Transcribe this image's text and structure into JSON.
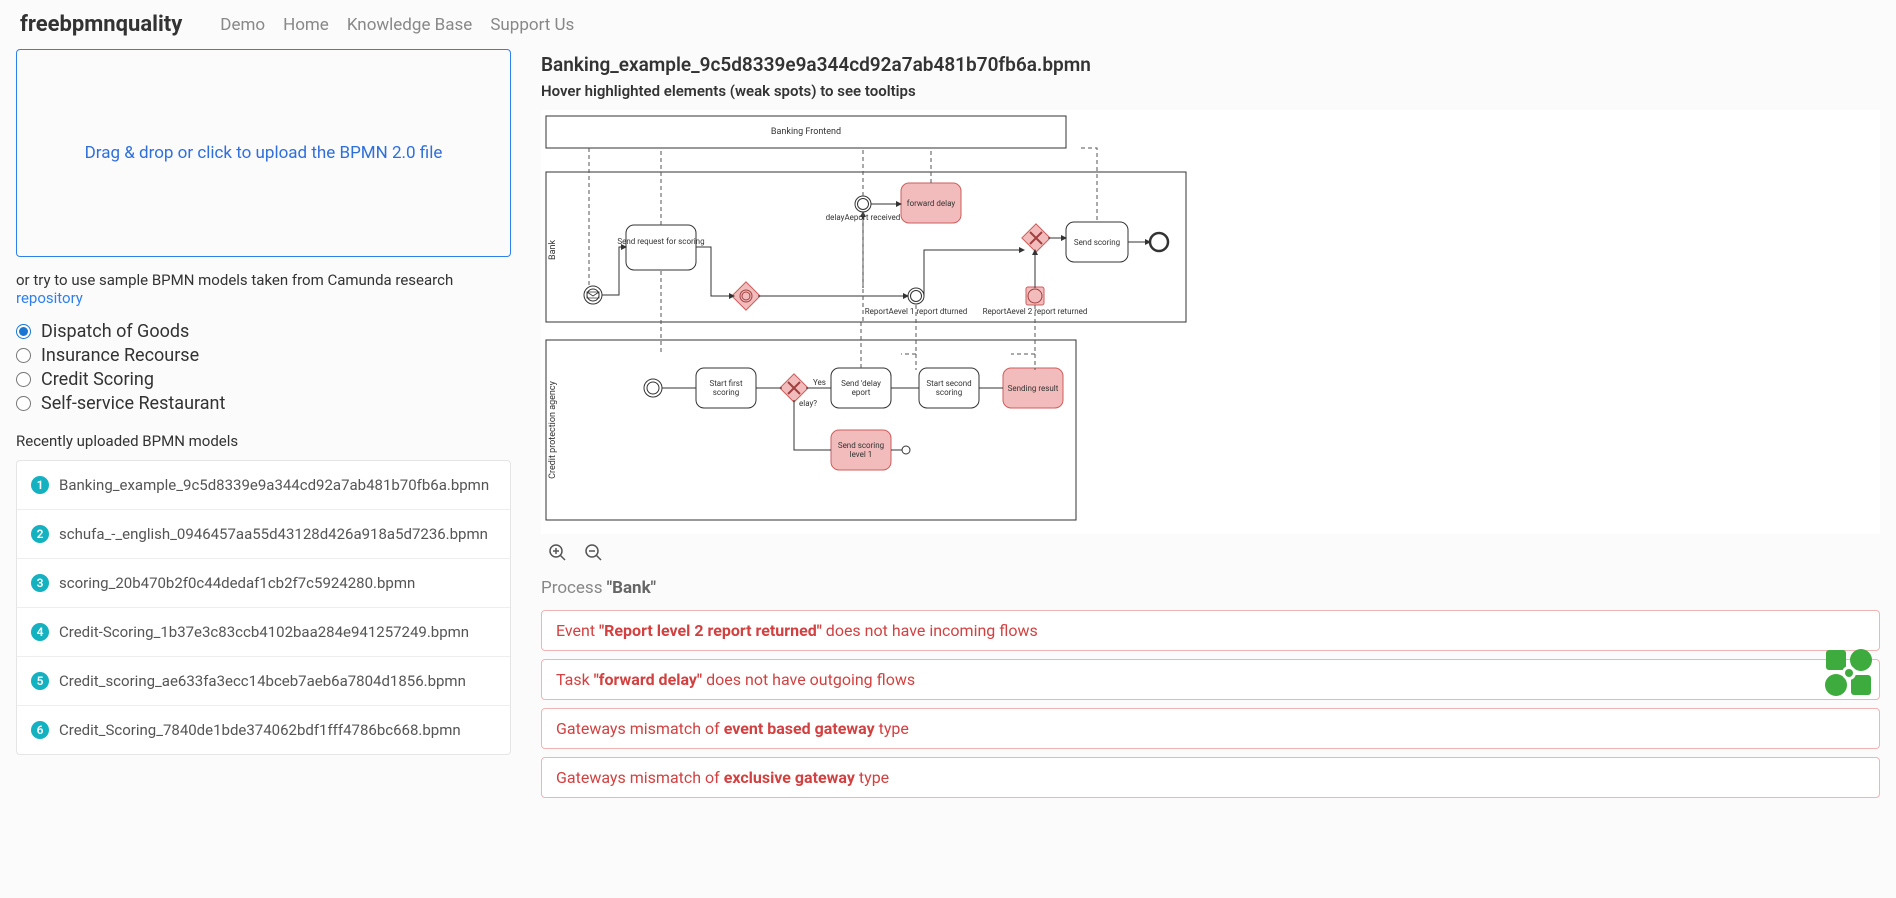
{
  "nav": {
    "brand": "freebpmnquality",
    "links": [
      "Demo",
      "Home",
      "Knowledge Base",
      "Support Us"
    ]
  },
  "upload": {
    "label": "Drag & drop or click to upload the BPMN 2.0 file"
  },
  "hint": {
    "prefix": "or try to use sample BPMN models taken from Camunda research ",
    "link": "repository"
  },
  "samples": [
    "Dispatch of Goods",
    "Insurance Recourse",
    "Credit Scoring",
    "Self-service Restaurant"
  ],
  "recent_label": "Recently uploaded BPMN models",
  "recent": [
    "Banking_example_9c5d8339e9a344cd92a7ab481b70fb6a.bpmn",
    "schufa_-_english_0946457aa55d43128d426a918a5d7236.bpmn",
    "scoring_20b470b2f0c44dedaf1cb2f7c5924280.bpmn",
    "Credit-Scoring_1b37e3c83ccb4102baa284e941257249.bpmn",
    "Credit_scoring_ae633fa3ecc14bceb7aeb6a7804d1856.bpmn",
    "Credit_Scoring_7840de1bde374062bdf1fff4786bc668.bpmn"
  ],
  "file": {
    "title": "Banking_example_9c5d8339e9a344cd92a7ab481b70fb6a.bpmn",
    "subtitle": "Hover highlighted elements (weak spots) to see tooltips"
  },
  "diagram": {
    "participants": [
      "Banking Frontend",
      "Bank",
      "Credit protection agency"
    ],
    "tasks": {
      "send_request": "Send request for scoring",
      "forward_delay": "forward delay",
      "send_scoring": "Send scoring",
      "start_first": "Start first scoring",
      "send_delay_report": "Send 'delay eport",
      "start_second": "Start second scoring",
      "sending_result": "Sending result",
      "send_scoring_l1": "Send scoring level 1"
    },
    "events": {
      "delay_report_received": "delayAeport received",
      "report_level1": "ReportAevel 1 report dturned",
      "report_level2": "ReportAevel 2 report returned",
      "gw_delay": "Yes elay?"
    }
  },
  "process_label_prefix": "Process ",
  "process_label_name": "\"Bank\"",
  "issues": [
    {
      "p1": "Event ",
      "b": "\"Report level 2 report returned\"",
      "p2": " does not have incoming flows"
    },
    {
      "p1": "Task ",
      "b": "\"forward delay\"",
      "p2": " does not have outgoing flows"
    },
    {
      "p1": "Gateways mismatch of ",
      "b": "event based gateway",
      "p2": " type"
    },
    {
      "p1": "Gateways mismatch of ",
      "b": "exclusive gateway",
      "p2": " type"
    }
  ]
}
